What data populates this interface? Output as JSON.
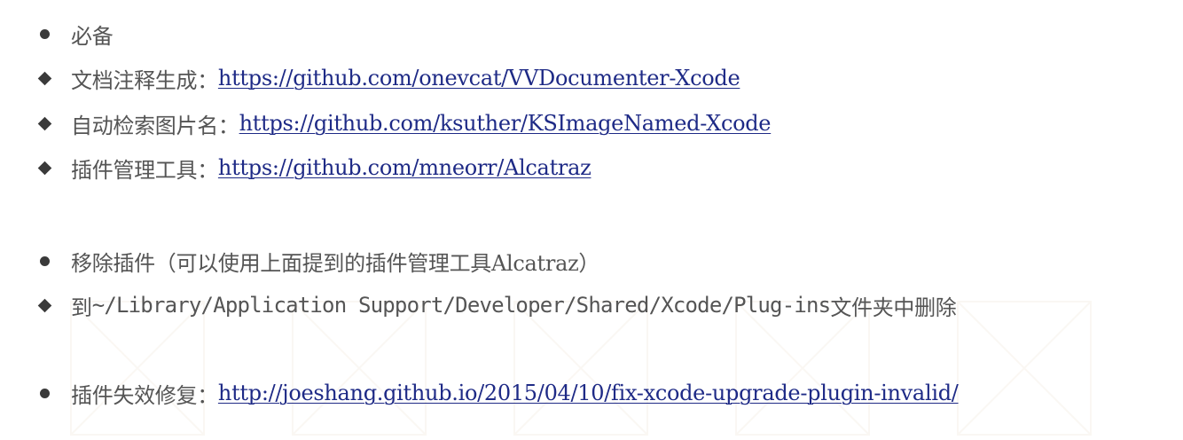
{
  "items": [
    {
      "bullet": "dot",
      "label": "必备",
      "url": ""
    },
    {
      "bullet": "diamond",
      "label": "文档注释生成：",
      "url": "https://github.com/onevcat/VVDocumenter-Xcode"
    },
    {
      "bullet": "diamond",
      "label": "自动检索图片名：",
      "url": "https://github.com/ksuther/KSImageNamed-Xcode"
    },
    {
      "bullet": "diamond",
      "label": "插件管理工具：",
      "url": "https://github.com/mneorr/Alcatraz"
    },
    {
      "bullet": "dot",
      "label": "移除插件（可以使用上面提到的插件管理工具Alcatraz）",
      "url": ""
    },
    {
      "bullet": "diamond",
      "label_prefix": "到",
      "label_path": "~/Library/Application Support/Developer/Shared/Xcode/Plug-ins",
      "label_suffix": "文件夹中删除"
    },
    {
      "bullet": "dot",
      "label": "插件失效修复：",
      "url": "http://joeshang.github.io/2015/04/10/fix-xcode-upgrade-plugin-invalid/"
    }
  ],
  "colors": {
    "text": "#555555",
    "link": "#1e2a86",
    "bullet": "#3a3a3a"
  }
}
